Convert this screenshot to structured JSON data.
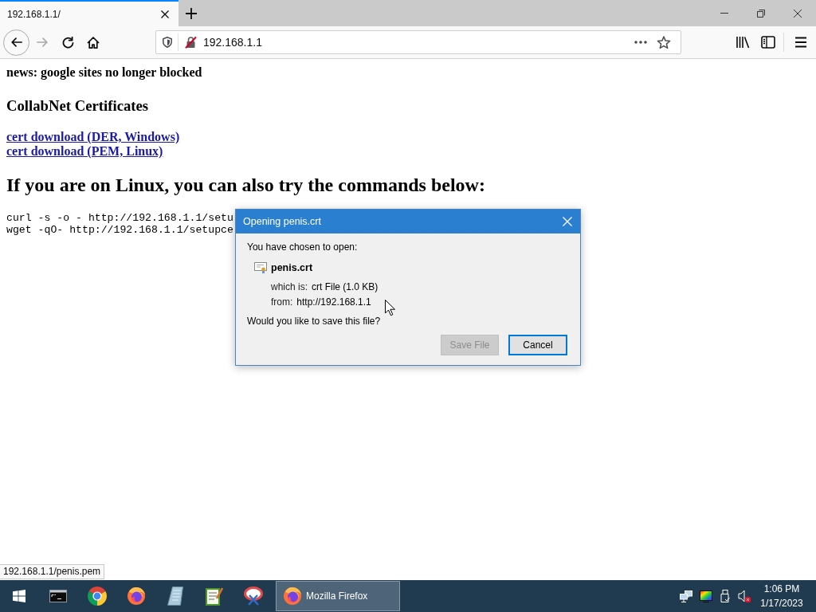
{
  "browser": {
    "tabs": [
      {
        "title": "192.168.1.1/",
        "selected": true
      }
    ],
    "nav_buttons": [
      {
        "kind": "back",
        "disabled": false
      },
      {
        "kind": "forward",
        "disabled": true
      },
      {
        "kind": "reload",
        "disabled": false
      },
      {
        "kind": "home",
        "disabled": false
      }
    ],
    "address_bar": {
      "value": "192.168.1.1"
    }
  },
  "page": {
    "news": "news: google sites no longer blocked",
    "heading": "CollabNet Certificates",
    "links": [
      "cert download (DER, Windows)",
      "cert download (PEM, Linux)"
    ],
    "commands_heading": "If you are on Linux, you can also try the commands below:",
    "commands": [
      "curl -s -o - http://192.168.1.1/setu",
      "wget -qO- http://192.168.1.1/setupce"
    ]
  },
  "status_tooltip": "192.168.1.1/penis.pem",
  "dialog": {
    "title": "Opening penis.crt",
    "intro": "You have chosen to open:",
    "file_name": "penis.crt",
    "type_label": "which is:",
    "type_value": "crt File (1.0 KB)",
    "from_label": "from:",
    "from_value": "http://192.168.1.1",
    "question": "Would you like to save this file?",
    "buttons": [
      {
        "label": "Save File",
        "disabled": true,
        "focused": false
      },
      {
        "label": "Cancel",
        "disabled": false,
        "focused": true
      }
    ]
  },
  "taskbar": {
    "windows": [
      {
        "label": "Mozilla Firefox",
        "selected": true
      }
    ],
    "tray": {
      "muted": true,
      "time": "1:06 PM",
      "date": "1/17/2023"
    }
  }
}
